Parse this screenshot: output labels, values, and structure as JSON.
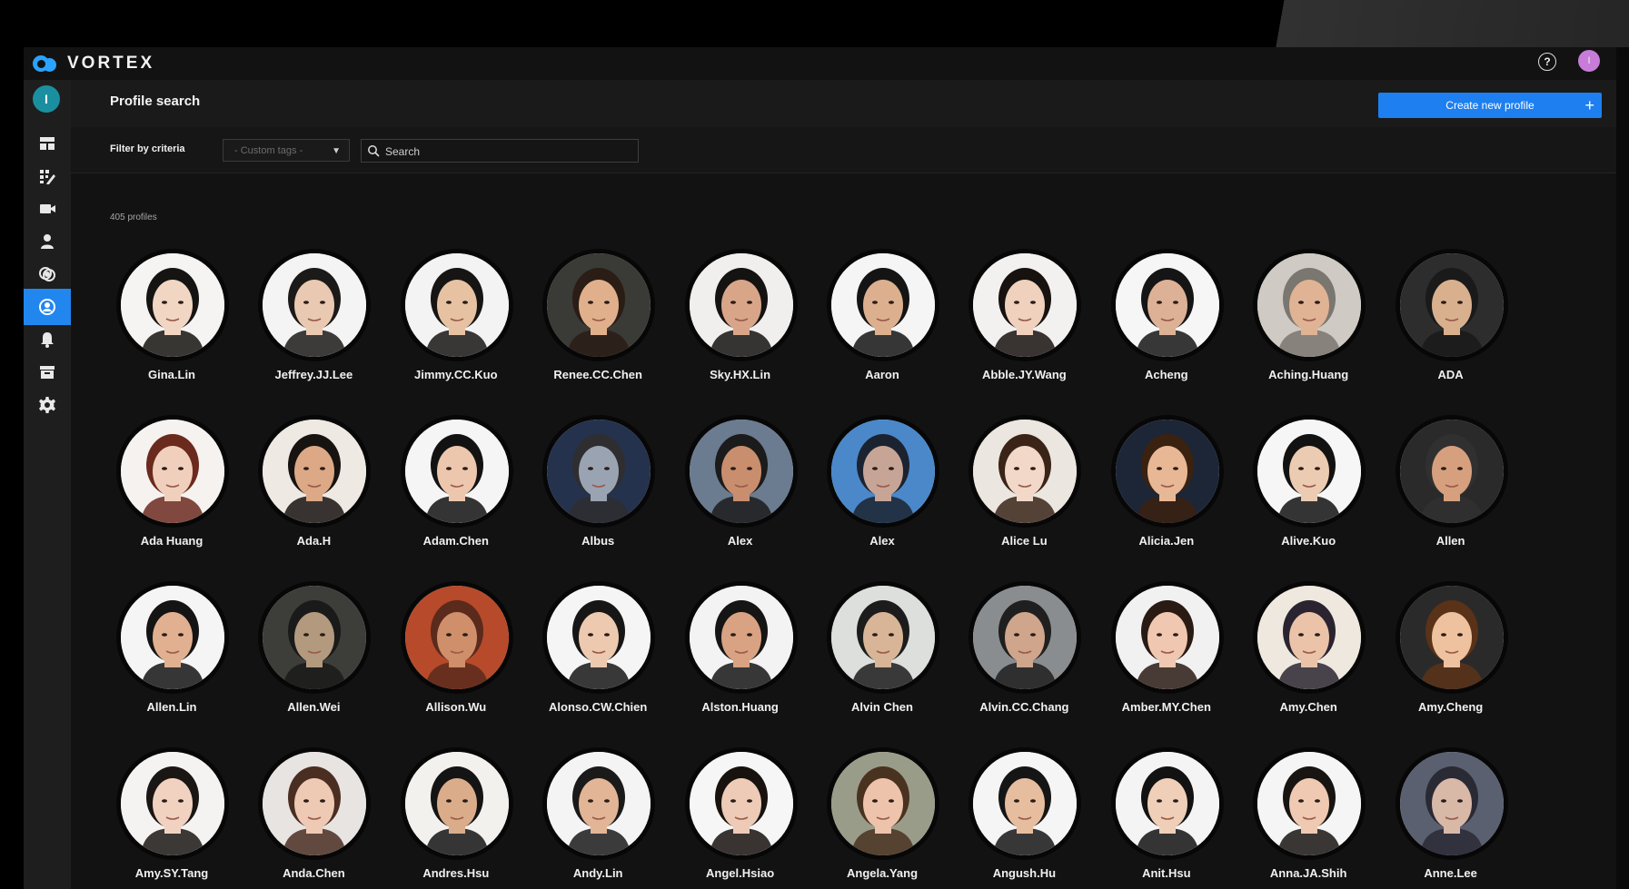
{
  "app": {
    "logo_text": "VORTEX",
    "help_icon": "help-circle-icon",
    "user_initial": "I"
  },
  "sidebar": {
    "avatar_initial": "I",
    "items": [
      {
        "icon": "dashboard-icon",
        "active": false
      },
      {
        "icon": "rules-icon",
        "active": false
      },
      {
        "icon": "camera-icon",
        "active": false
      },
      {
        "icon": "person-icon",
        "active": false
      },
      {
        "icon": "compare-icon",
        "active": false
      },
      {
        "icon": "profile-search-icon",
        "active": true
      },
      {
        "icon": "bell-icon",
        "active": false
      },
      {
        "icon": "archive-icon",
        "active": false
      },
      {
        "icon": "gear-icon",
        "active": false
      }
    ]
  },
  "header": {
    "title": "Profile search",
    "create_button": "Create new profile",
    "create_icon": "plus-icon"
  },
  "filters": {
    "label": "Filter by criteria",
    "tags_placeholder": "- Custom tags -",
    "search_placeholder": "Search"
  },
  "profiles_count": "405 profiles",
  "profiles": [
    {
      "name": "Gina.Lin",
      "skin": "#f1d6c4",
      "hair": "#161412",
      "bg": "#f6f4f2"
    },
    {
      "name": "Jeffrey.JJ.Lee",
      "skin": "#e9c9b1",
      "hair": "#1b1a18",
      "bg": "#f4f4f4"
    },
    {
      "name": "Jimmy.CC.Kuo",
      "skin": "#e6c2a3",
      "hair": "#161514",
      "bg": "#f3f3f3"
    },
    {
      "name": "Renee.CC.Chen",
      "skin": "#e0b08d",
      "hair": "#2a1d15",
      "bg": "#3a3a36"
    },
    {
      "name": "Sky.HX.Lin",
      "skin": "#d9a588",
      "hair": "#141312",
      "bg": "#f0efee"
    },
    {
      "name": "Aaron",
      "skin": "#dcb08e",
      "hair": "#141414",
      "bg": "#f5f5f5"
    },
    {
      "name": "Abble.JY.Wang",
      "skin": "#efd1bd",
      "hair": "#17120f",
      "bg": "#f3f1f0"
    },
    {
      "name": "Acheng",
      "skin": "#ddb195",
      "hair": "#151515",
      "bg": "#f6f6f6"
    },
    {
      "name": "Aching.Huang",
      "skin": "#dfb394",
      "hair": "#7a7670",
      "bg": "#cfcac3"
    },
    {
      "name": "ADA",
      "skin": "#d9b08e",
      "hair": "#1a1a1a",
      "bg": "#2d2d2d"
    },
    {
      "name": "Ada Huang",
      "skin": "#f0d0bd",
      "hair": "#6b2a1e",
      "bg": "#f5f2f0"
    },
    {
      "name": "Ada.H",
      "skin": "#dca886",
      "hair": "#171310",
      "bg": "#efe9e4"
    },
    {
      "name": "Adam.Chen",
      "skin": "#ecc7ad",
      "hair": "#121212",
      "bg": "#f5f5f5"
    },
    {
      "name": "Albus",
      "skin": "#9aa3b2",
      "hair": "#2e2e30",
      "bg": "#25324d"
    },
    {
      "name": "Alex",
      "skin": "#c98e6e",
      "hair": "#1b1b1b",
      "bg": "#6b7b90"
    },
    {
      "name": "Alex",
      "skin": "#c7a596",
      "hair": "#1b2330",
      "bg": "#4a88c9"
    },
    {
      "name": "Alice Lu",
      "skin": "#f2d8c8",
      "hair": "#3a2418",
      "bg": "#ece6e1"
    },
    {
      "name": "Alicia.Jen",
      "skin": "#e8b896",
      "hair": "#3b2110",
      "bg": "#1d2636"
    },
    {
      "name": "Alive.Kuo",
      "skin": "#eccbb3",
      "hair": "#121212",
      "bg": "#f6f6f6"
    },
    {
      "name": "Allen",
      "skin": "#d6a07e",
      "hair": "#303030",
      "bg": "#2a2a2a"
    },
    {
      "name": "Allen.Lin",
      "skin": "#e0b090",
      "hair": "#141414",
      "bg": "#f5f5f5"
    },
    {
      "name": "Allen.Wei",
      "skin": "#b39a7e",
      "hair": "#1a1a1a",
      "bg": "#3d3d3a"
    },
    {
      "name": "Allison.Wu",
      "skin": "#cf8f6a",
      "hair": "#5a2a1c",
      "bg": "#b64a2a"
    },
    {
      "name": "Alonso.CW.Chien",
      "skin": "#edc9b0",
      "hair": "#161616",
      "bg": "#f5f5f5"
    },
    {
      "name": "Alston.Huang",
      "skin": "#d9a282",
      "hair": "#151515",
      "bg": "#f3f3f3"
    },
    {
      "name": "Alvin Chen",
      "skin": "#d8b596",
      "hair": "#1c1c1c",
      "bg": "#dcdfdc"
    },
    {
      "name": "Alvin.CC.Chang",
      "skin": "#cfa58c",
      "hair": "#1f1f1f",
      "bg": "#8a8d90"
    },
    {
      "name": "Amber.MY.Chen",
      "skin": "#f0c7b0",
      "hair": "#2a1a14",
      "bg": "#f1f1f1"
    },
    {
      "name": "Amy.Chen",
      "skin": "#eac3a8",
      "hair": "#2a2430",
      "bg": "#efe8df"
    },
    {
      "name": "Amy.Cheng",
      "skin": "#eec29f",
      "hair": "#5a3218",
      "bg": "#2a2a2a"
    },
    {
      "name": "Amy.SY.Tang",
      "skin": "#f1d2c1",
      "hair": "#1a1614",
      "bg": "#f5f3f2"
    },
    {
      "name": "Anda.Chen",
      "skin": "#eec9b4",
      "hair": "#4a2e22",
      "bg": "#e8e4e2"
    },
    {
      "name": "Andres.Hsu",
      "skin": "#dbac8a",
      "hair": "#141414",
      "bg": "#f3f1ee"
    },
    {
      "name": "Andy.Lin",
      "skin": "#e2b597",
      "hair": "#1a1a1a",
      "bg": "#f4f4f4"
    },
    {
      "name": "Angel.Hsiao",
      "skin": "#edcbb6",
      "hair": "#18120f",
      "bg": "#f6f6f6"
    },
    {
      "name": "Angela.Yang",
      "skin": "#eec3ab",
      "hair": "#4a3220",
      "bg": "#9a9c8a"
    },
    {
      "name": "Angush.Hu",
      "skin": "#e6bd9f",
      "hair": "#151515",
      "bg": "#f5f5f5"
    },
    {
      "name": "Anit.Hsu",
      "skin": "#efcfb8",
      "hair": "#121212",
      "bg": "#f4f4f4"
    },
    {
      "name": "Anna.JA.Shih",
      "skin": "#efc9b1",
      "hair": "#171412",
      "bg": "#f5f5f5"
    },
    {
      "name": "Anne.Lee",
      "skin": "#d8b8a7",
      "hair": "#2a2a35",
      "bg": "#5a6070"
    }
  ]
}
